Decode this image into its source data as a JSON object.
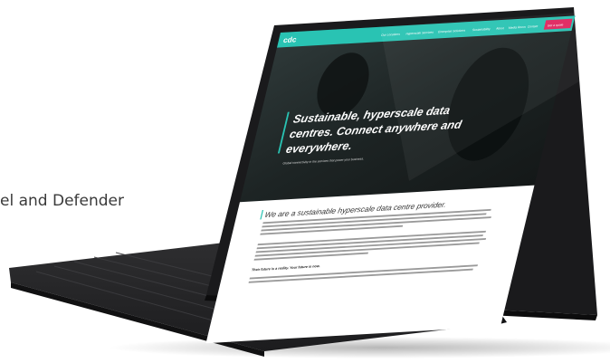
{
  "page": {
    "partial_heading": "el and Defender"
  },
  "website": {
    "logo": "cdc",
    "nav": [
      "Our Locations",
      "Hyperscale Services",
      "Enterprise Solutions",
      "Sustainability",
      "About",
      "Media Room",
      "Contact"
    ],
    "cta": "Get a quote",
    "hero": {
      "headline_lines": [
        "Sustainable, hyperscale data",
        "centres. Connect anywhere and",
        "everywhere."
      ],
      "subline": "Global connectivity to the services that power your business."
    },
    "section": {
      "heading": "We are a sustainable hyperscale data centre provider.",
      "subheading": "Their future is a reality. Your future is now."
    }
  },
  "colors": {
    "accent": "#29c3b3",
    "cta": "#e0245e",
    "device_frame": "#1a1a1c",
    "keyboard": "#2a2a2c"
  }
}
